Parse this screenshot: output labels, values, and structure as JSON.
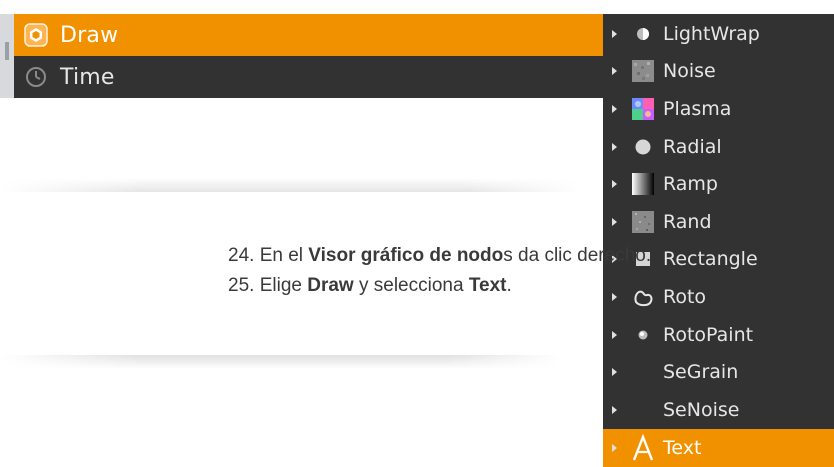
{
  "top_menu": {
    "items": [
      {
        "label": "Draw",
        "icon": "draw-node-icon",
        "selected": true
      },
      {
        "label": "Time",
        "icon": "clock-icon",
        "selected": false
      }
    ]
  },
  "submenu": {
    "items": [
      {
        "label": "LightWrap",
        "icon": "lightwrap-icon"
      },
      {
        "label": "Noise",
        "icon": "noise-icon"
      },
      {
        "label": "Plasma",
        "icon": "plasma-icon"
      },
      {
        "label": "Radial",
        "icon": "radial-icon"
      },
      {
        "label": "Ramp",
        "icon": "ramp-icon"
      },
      {
        "label": "Rand",
        "icon": "rand-icon"
      },
      {
        "label": "Rectangle",
        "icon": "rectangle-icon"
      },
      {
        "label": "Roto",
        "icon": "roto-icon"
      },
      {
        "label": "RotoPaint",
        "icon": "rotopaint-icon"
      },
      {
        "label": "SeGrain",
        "icon": ""
      },
      {
        "label": "SeNoise",
        "icon": ""
      },
      {
        "label": "Text",
        "icon": "text-icon",
        "selected": true
      }
    ]
  },
  "instructions": {
    "step1": {
      "number": "24.",
      "pre": "En el ",
      "bold": "Visor gráfico de nodo",
      "mid": "s da clic derecho."
    },
    "step2": {
      "number": "25.",
      "pre": "Elige ",
      "bold1": "Draw",
      "mid": " y selecciona ",
      "bold2": "Text",
      "end": "."
    }
  },
  "colors": {
    "menu_bg": "#323232",
    "highlight": "#f29100",
    "menu_text": "#e6e6e6"
  }
}
